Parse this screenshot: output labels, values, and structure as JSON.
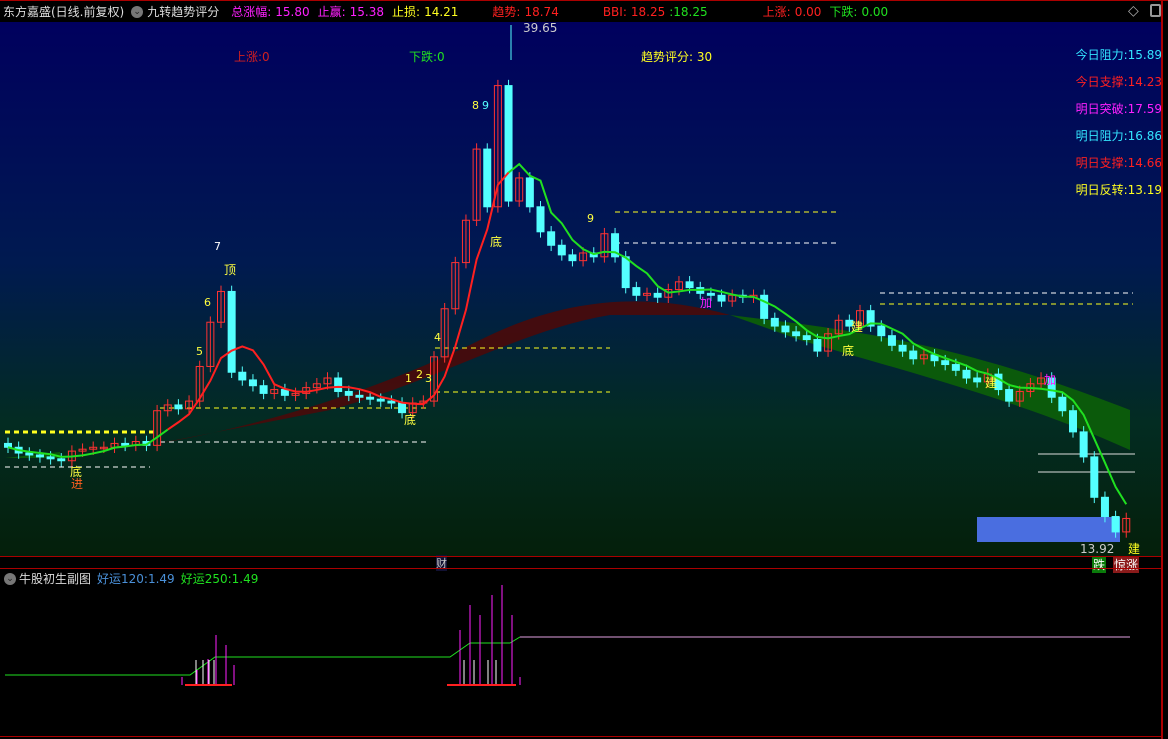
{
  "header": {
    "stock": "东方嘉盛(日线.前复权)",
    "indicator": "九转趋势评分",
    "total_gain_label": "总涨幅:",
    "total_gain": "15.80",
    "take_profit_label": "止赢:",
    "take_profit": "15.38",
    "stop_loss_label": "止损:",
    "stop_loss": "14.21",
    "trend_label": "趋势:",
    "trend": "18.74",
    "bbi_label": "BBI:",
    "bbi_a": "18.25",
    "bbi_b": ":18.25",
    "up_label": "上涨:",
    "up": "0.00",
    "down_label": "下跌:",
    "down": "0.00"
  },
  "main": {
    "up_count": "上涨:0",
    "down_count": "下跌:0",
    "score_label": "趋势评分:",
    "score": "30",
    "high_mark": "39.65",
    "low_mark": "13.92",
    "levels": [
      {
        "label": "今日阻力:",
        "value": "15.89",
        "color": "#33e6ff"
      },
      {
        "label": "今日支撑:",
        "value": "14.23",
        "color": "#ff2020"
      },
      {
        "label": "明日突破:",
        "value": "17.59",
        "color": "#ff20ff"
      },
      {
        "label": "明日阻力:",
        "value": "16.86",
        "color": "#33e6ff"
      },
      {
        "label": "明日支撑:",
        "value": "14.66",
        "color": "#ff2020"
      },
      {
        "label": "明日反转:",
        "value": "13.19",
        "color": "#ffff20"
      }
    ],
    "signals": {
      "bottom": "底",
      "enter": "进",
      "top": "顶",
      "build": "建",
      "add": "加",
      "wealth": "财",
      "fall": "跌",
      "surge": "惊涨"
    },
    "seq": {
      "s7": "7",
      "s8": "8",
      "s9": "9",
      "s6": "6",
      "s5": "5",
      "s4": "4",
      "s3": "3",
      "s2": "2",
      "s1": "1"
    }
  },
  "sub": {
    "title": "牛股初生副图",
    "luck120_label": "好运120:",
    "luck120": "1.49",
    "luck250_label": "好运250:",
    "luck250": "1.49"
  },
  "chart_data": {
    "type": "candlestick",
    "ylim": [
      13.92,
      39.65
    ],
    "closes": [
      19.0,
      18.7,
      18.6,
      18.5,
      18.4,
      18.3,
      18.8,
      18.9,
      19.0,
      19.0,
      19.2,
      19.1,
      19.3,
      19.1,
      20.9,
      21.2,
      21.0,
      21.4,
      23.2,
      25.5,
      27.1,
      22.9,
      22.5,
      22.2,
      21.8,
      22.0,
      21.7,
      21.8,
      22.1,
      22.3,
      22.6,
      21.9,
      21.7,
      21.6,
      21.5,
      21.4,
      21.3,
      20.8,
      21.3,
      21.4,
      23.7,
      26.2,
      28.6,
      30.8,
      34.5,
      31.5,
      37.8,
      31.8,
      33.0,
      31.5,
      30.2,
      29.5,
      29.0,
      28.7,
      29.1,
      28.9,
      30.1,
      28.9,
      27.3,
      26.9,
      27.0,
      26.8,
      27.2,
      27.6,
      27.3,
      27.0,
      26.9,
      26.6,
      26.9,
      26.8,
      26.9,
      25.7,
      25.3,
      25.0,
      24.8,
      24.6,
      24.0,
      24.9,
      25.6,
      25.3,
      26.1,
      25.3,
      24.8,
      24.3,
      24.0,
      23.6,
      23.8,
      23.5,
      23.3,
      23.0,
      22.6,
      22.4,
      22.8,
      22.0,
      21.4,
      21.9,
      22.3,
      22.6,
      21.6,
      20.9,
      19.8,
      18.5,
      16.4,
      15.4,
      14.6,
      15.3
    ]
  },
  "colors": {
    "up": "#ff3232",
    "down": "#54ffff",
    "ma": "#20e020",
    "rally": "#ff2020"
  }
}
